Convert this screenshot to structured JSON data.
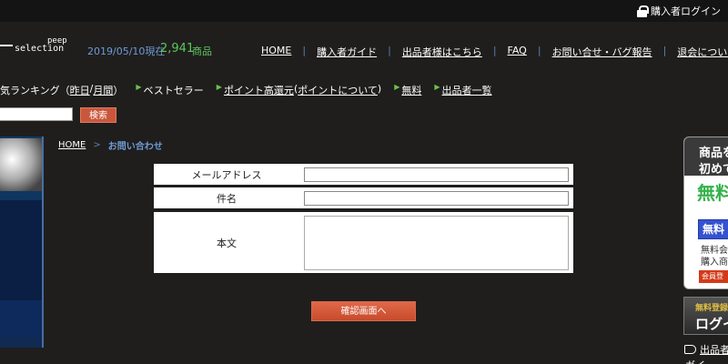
{
  "topbar": {
    "login_label": "購入者ログイン"
  },
  "logo": {
    "line1": "peep",
    "line2": "selection"
  },
  "header": {
    "date": "2019/05/10現在",
    "count": "2,941",
    "unit": "商品",
    "nav": [
      "HOME",
      "購入者ガイド",
      "出品者様はこちら",
      "FAQ",
      "お問い合せ・バグ報告",
      "退会について"
    ],
    "nav_sep": "|"
  },
  "subnav": {
    "ranking_prefix": "気ランキング（",
    "ranking_yesterday": "昨日",
    "ranking_slash": " / ",
    "ranking_month": "月間",
    "ranking_suffix": "）",
    "bestseller": "ベストセラー",
    "points_link": "ポイント高還元",
    "points_open": " (",
    "points_about": "ポイントについて",
    "points_close": ")",
    "free": "無料",
    "sellers": "出品者一覧"
  },
  "search": {
    "button_label": "検索",
    "input_value": ""
  },
  "breadcrumb": {
    "home": "HOME",
    "sep": ">",
    "current": "お問い合わせ"
  },
  "form": {
    "email_label": "メールアドレス",
    "subject_label": "件名",
    "body_label": "本文",
    "submit_label": "確認画面へ"
  },
  "right_banner": {
    "line1": "商品を",
    "line2": "初めて",
    "big": "無料",
    "blue": "無料",
    "small1": "無料会",
    "small2": "購入商",
    "red": "会員登"
  },
  "right_login": {
    "top": "無料登録",
    "bottom": "ログイ"
  },
  "right_links": {
    "link1": "出品者",
    "link2": "ガイ"
  },
  "colors": {
    "accent_blue": "#6f9bd6",
    "accent_green": "#5bc95b",
    "button_red": "#c9573b"
  }
}
